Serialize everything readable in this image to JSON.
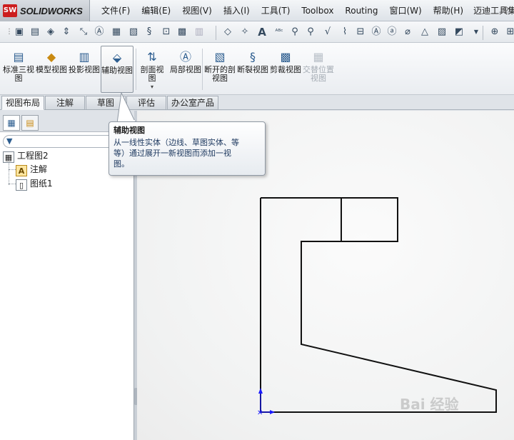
{
  "app": {
    "logo_mark": "SW",
    "brand": "SOLIDWORKS"
  },
  "menu": [
    {
      "label": "文件(F)"
    },
    {
      "label": "编辑(E)"
    },
    {
      "label": "视图(V)"
    },
    {
      "label": "插入(I)"
    },
    {
      "label": "工具(T)"
    },
    {
      "label": "Toolbox"
    },
    {
      "label": "Routing"
    },
    {
      "label": "窗口(W)"
    },
    {
      "label": "帮助(H)"
    },
    {
      "label": "迈迪工具集"
    }
  ],
  "ribbon": {
    "standard_3view": "标准三视图",
    "model_view": "模型视图",
    "projected_view": "投影视图",
    "auxiliary_view": "辅助视图",
    "section_view": "剖面视图",
    "detail_view": "局部视图",
    "broken_out_section": "断开的剖视图",
    "break_view": "断裂视图",
    "crop_view": "剪裁视图",
    "alternate_position": "交替位置视图"
  },
  "tabs": [
    "视图布局",
    "注解",
    "草图",
    "评估",
    "办公室产品"
  ],
  "tree": {
    "root": "工程图2",
    "annotations": "注解",
    "sheet": "图纸1"
  },
  "tooltip": {
    "title": "辅助视图",
    "line1": "从一线性实体（边线、草图实体、等",
    "line2": "等）通过展开一新视图而添加一视",
    "line3": "图。"
  },
  "watermark": "Bai 经验",
  "colors": {
    "accent": "#2c5d8f",
    "logo": "#cc1e1e",
    "axis": "#1a1aff"
  }
}
